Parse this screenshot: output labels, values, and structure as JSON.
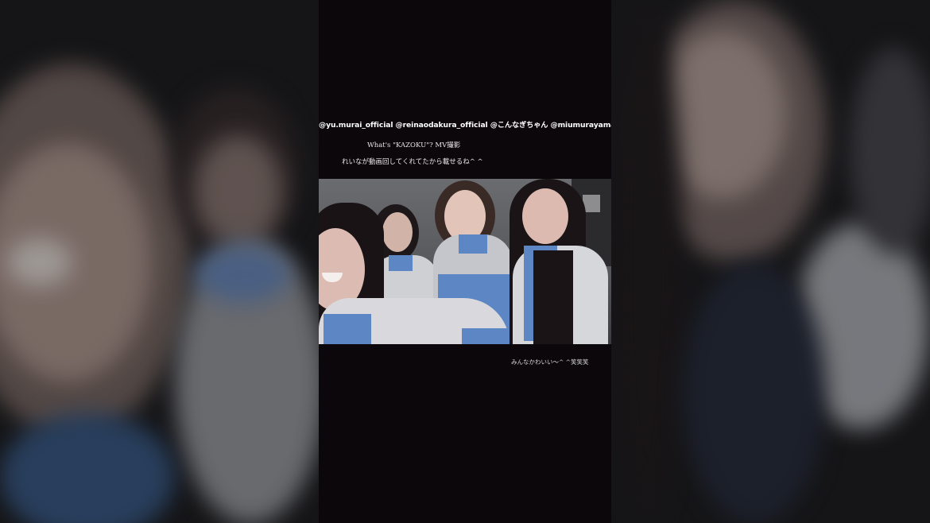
{
  "post": {
    "tags": "@yu.murai_official @reinaodakura_official @こんなぎちゃん @miumurayama_official",
    "caption_line1": "What's \"KAZOKU\"?   MV撮影",
    "caption_line2": "れいなが動画回してくれてたから載せるね^ ^",
    "bottom_note": "みんなかわいい〜^ ^笑笑笑"
  },
  "colors": {
    "reel_background": "#0b070b",
    "photo_wall": "#5b5c60",
    "uniform_blue": "#5d86c4",
    "backdrop": "#1f1f22"
  }
}
